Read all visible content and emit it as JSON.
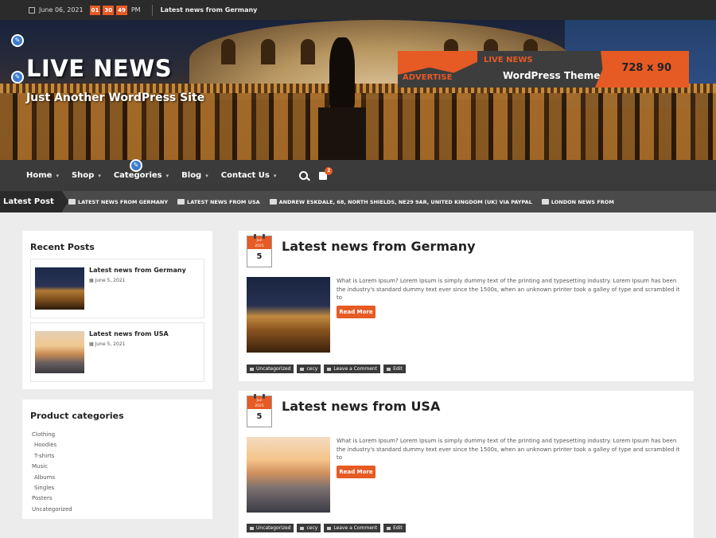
{
  "topbar": {
    "date": "June 06, 2021",
    "clock": [
      "01",
      "30",
      "49"
    ],
    "ampm": "PM",
    "headline": "Latest news from Germany"
  },
  "header": {
    "site_title": "LIVE NEWS",
    "tagline": "Just Another WordPress Site",
    "ad": {
      "advertise": "ADVERTISE",
      "brand": "LIVE NEWS",
      "theme": "WordPress Theme",
      "size": "728 x 90"
    }
  },
  "nav": {
    "items": [
      {
        "label": "Home"
      },
      {
        "label": "Shop"
      },
      {
        "label": "Categories"
      },
      {
        "label": "Blog"
      },
      {
        "label": "Contact Us"
      }
    ],
    "cart_count": "2"
  },
  "ticker": {
    "label": "Latest Post",
    "items": [
      "LATEST NEWS FROM GERMANY",
      "LATEST NEWS FROM USA",
      "ANDREW ESKDALE, 68, NORTH SHIELDS, NE29 9AR, UNITED KINGDOM (UK) VIA PAYPAL",
      "LONDON NEWS FROM"
    ]
  },
  "sidebar": {
    "recent_title": "Recent Posts",
    "recent": [
      {
        "title": "Latest news from Germany",
        "date": "June 5, 2021"
      },
      {
        "title": "Latest news from USA",
        "date": "June 5, 2021"
      }
    ],
    "categories_title": "Product categories",
    "categories": [
      "Clothing",
      "Hoodies",
      "T-shirts",
      "Music",
      "Albums",
      "Singles",
      "Posters",
      "Uncategorized"
    ]
  },
  "posts": [
    {
      "month": "Jun",
      "year": "2021",
      "day": "5",
      "title": "Latest news from Germany",
      "excerpt": "What is Lorem Ipsum? Lorem Ipsum is simply dummy text of the printing and typesetting industry. Lorem Ipsum has been the industry's standard dummy text ever since the 1500s, when an unknown printer took a galley of type and scrambled it to",
      "read_more": "Read More",
      "meta": [
        "Uncategorized",
        "cecy",
        "Leave a Comment",
        "Edit"
      ]
    },
    {
      "month": "Jun",
      "year": "2021",
      "day": "5",
      "title": "Latest news from USA",
      "excerpt": "What is Lorem Ipsum? Lorem Ipsum is simply dummy text of the printing and typesetting industry. Lorem Ipsum has been the industry's standard dummy text ever since the 1500s, when an unknown printer took a galley of type and scrambled it to",
      "read_more": "Read More",
      "meta": [
        "Uncategorized",
        "cecy",
        "Leave a Comment",
        "Edit"
      ]
    }
  ]
}
